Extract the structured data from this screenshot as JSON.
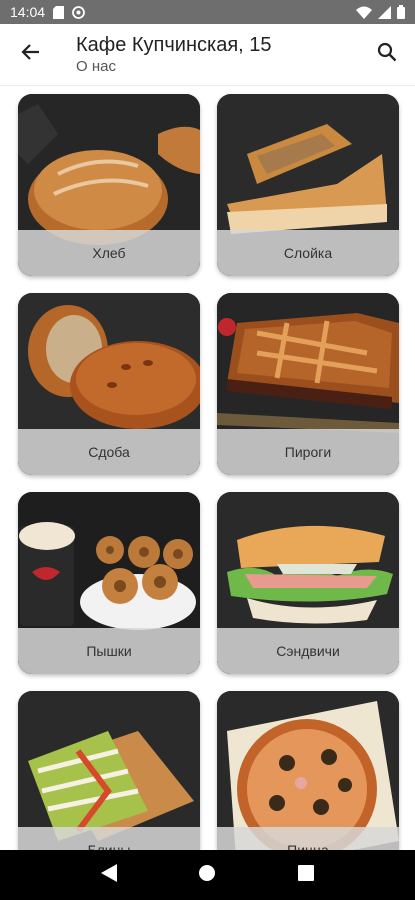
{
  "status_bar": {
    "time": "14:04",
    "icons": [
      "sd-card-icon",
      "at-sign-icon",
      "wifi-icon",
      "signal-icon",
      "battery-icon"
    ]
  },
  "app_bar": {
    "title": "Кафе Купчинская, 15",
    "subtitle": "О нас",
    "back_icon": "arrow-left-icon",
    "search_icon": "search-icon"
  },
  "categories": [
    {
      "label": "Хлеб",
      "image": "bread"
    },
    {
      "label": "Слойка",
      "image": "puff-pastry"
    },
    {
      "label": "Сдоба",
      "image": "buns"
    },
    {
      "label": "Пироги",
      "image": "pie"
    },
    {
      "label": "Пышки",
      "image": "donuts"
    },
    {
      "label": "Сэндвичи",
      "image": "sandwich"
    },
    {
      "label": "Блины",
      "image": "crepe"
    },
    {
      "label": "Пицца",
      "image": "pizza"
    }
  ],
  "nav_bar": {
    "icons": [
      "back-triangle-icon",
      "home-circle-icon",
      "recents-square-icon"
    ]
  },
  "colors": {
    "status_bar": "#6e6e6e",
    "label_bg": "#d7d7d7",
    "nav_bar": "#000000"
  }
}
